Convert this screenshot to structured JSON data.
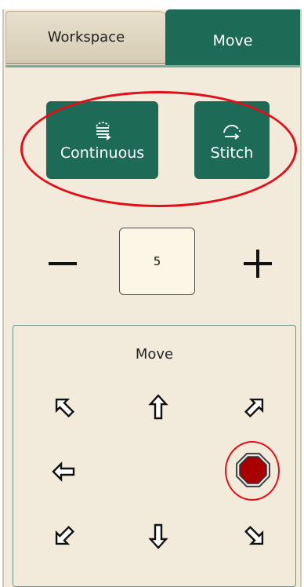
{
  "tabs": {
    "workspace": "Workspace",
    "move": "Move",
    "active": "Move"
  },
  "modes": {
    "continuous_label": "Continuous",
    "stitch_label": "Stitch"
  },
  "stepper": {
    "value": "5",
    "minus_icon": "minus-icon",
    "plus_icon": "plus-icon"
  },
  "move_group": {
    "title": "Move",
    "arrows": [
      "arrow-up-left-icon",
      "arrow-up-icon",
      "arrow-up-right-icon",
      "arrow-left-icon",
      "stop-icon",
      "arrow-down-left-icon",
      "arrow-down-icon",
      "arrow-down-right-icon"
    ]
  },
  "colors": {
    "accent": "#1d6b56",
    "panel_bg": "#f2ebdb",
    "annotation": "#e0101a",
    "stop": "#a80000"
  }
}
